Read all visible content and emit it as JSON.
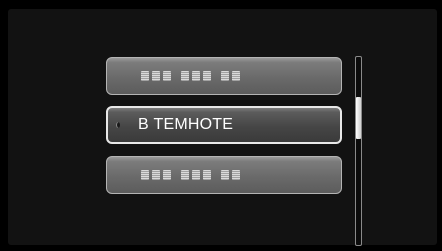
{
  "menu": {
    "items": [
      {
        "label": "",
        "state": "obscured"
      },
      {
        "label": "В ТЕМНОТЕ",
        "state": "selected"
      },
      {
        "label": "",
        "state": "obscured"
      }
    ]
  },
  "scroll": {
    "position": 0.25
  },
  "colors": {
    "background": "#000000",
    "item_selected_border": "#e8e8e8",
    "text": "#ffffff"
  }
}
